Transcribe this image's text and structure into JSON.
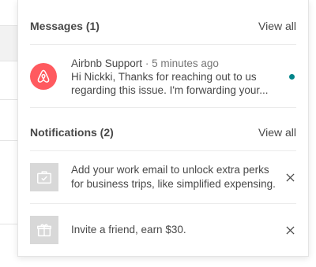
{
  "messages": {
    "title": "Messages (1)",
    "view_all": "View all",
    "items": [
      {
        "sender": "Airbnb Support",
        "separator": " · ",
        "time": "5 minutes ago",
        "preview": "Hi Nickki, Thanks for reaching out to us regarding this issue. I'm forwarding your...",
        "avatar_icon": "airbnb-logo-icon",
        "unread": true
      }
    ]
  },
  "notifications": {
    "title": "Notifications (2)",
    "view_all": "View all",
    "items": [
      {
        "text": "Add your work email to unlock extra perks for business trips, like simplified expensing.",
        "icon": "briefcase-icon"
      },
      {
        "text": "Invite a friend, earn $30.",
        "icon": "gift-icon"
      }
    ]
  },
  "colors": {
    "brand": "#ff5a5f",
    "unread_dot": "#008489",
    "icon_bg": "#d8d8d8",
    "text": "#484848"
  }
}
